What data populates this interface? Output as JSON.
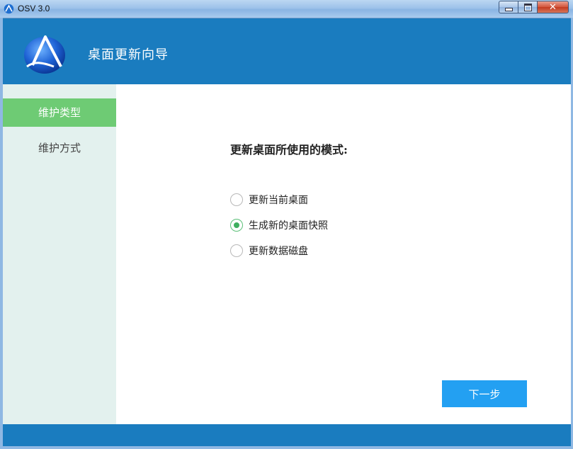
{
  "window": {
    "title": "OSV 3.0",
    "close_glyph": "✕"
  },
  "header": {
    "title": "桌面更新向导"
  },
  "sidebar": {
    "items": [
      {
        "label": "维护类型",
        "active": true
      },
      {
        "label": "维护方式",
        "active": false
      }
    ]
  },
  "main": {
    "question": "更新桌面所使用的模式:",
    "options": [
      {
        "label": "更新当前桌面",
        "checked": false
      },
      {
        "label": "生成新的桌面快照",
        "checked": true
      },
      {
        "label": "更新数据磁盘",
        "checked": false
      }
    ],
    "next_label": "下一步"
  },
  "colors": {
    "header_bg": "#1a7cbf",
    "sidebar_bg": "#e3f1ee",
    "sidebar_active": "#6ecb74",
    "button_bg": "#23a0f2",
    "radio_checked": "#3fae5f"
  },
  "icons": {
    "app": "osv-logo-icon",
    "header_logo": "osv-logo-icon"
  }
}
